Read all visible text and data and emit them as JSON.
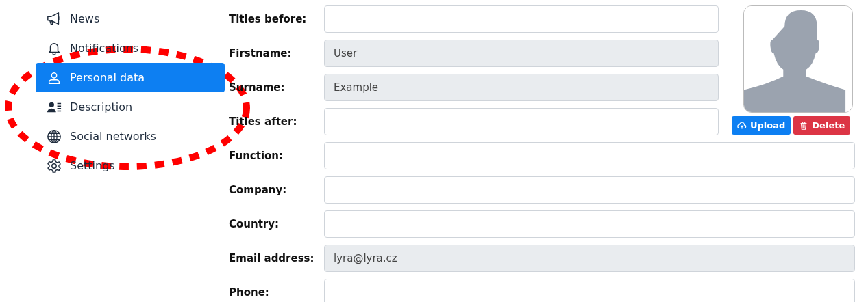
{
  "sidebar": {
    "items": [
      {
        "label": "News",
        "kind": "news",
        "selected": false
      },
      {
        "label": "Notifications",
        "kind": "notifications",
        "selected": false
      },
      {
        "label": "Personal data",
        "kind": "personal",
        "selected": true
      },
      {
        "label": "Description",
        "kind": "description",
        "selected": false
      },
      {
        "label": "Social networks",
        "kind": "social",
        "selected": false
      },
      {
        "label": "Settings",
        "kind": "settings",
        "selected": false
      }
    ]
  },
  "form": {
    "fields": [
      {
        "label": "Titles before:",
        "disabled": false
      },
      {
        "label": "Firstname:",
        "value": "User",
        "disabled": true
      },
      {
        "label": "Surname:",
        "value": "Example",
        "disabled": true
      },
      {
        "label": "Titles after:",
        "disabled": false
      },
      {
        "label": "Function:",
        "disabled": false
      },
      {
        "label": "Company:",
        "disabled": false
      },
      {
        "label": "Country:",
        "disabled": false
      },
      {
        "label": "Email address:",
        "value": "lyra@lyra.cz",
        "disabled": true
      },
      {
        "label": "Phone:",
        "disabled": false
      }
    ]
  },
  "photo": {
    "buttons": [
      {
        "label": "Upload",
        "kind": "primary"
      },
      {
        "label": "Delete",
        "kind": "danger"
      }
    ]
  },
  "annotation": {
    "kind": "dashed-ellipse"
  }
}
